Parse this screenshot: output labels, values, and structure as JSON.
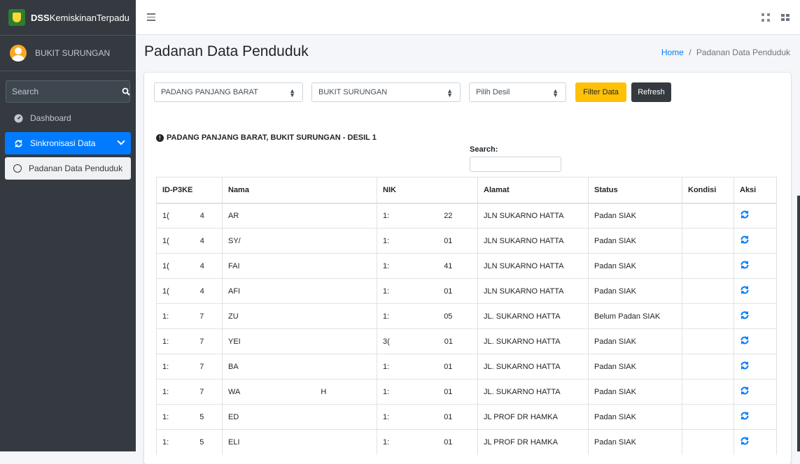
{
  "brand": {
    "bold": "DSS",
    "rest": "KemiskinanTerpadu"
  },
  "user": {
    "name": "BUKIT SURUNGAN"
  },
  "sidebar": {
    "search_placeholder": "Search",
    "items": [
      {
        "label": "Dashboard",
        "icon": "dashboard-icon"
      },
      {
        "label": "Sinkronisasi Data",
        "icon": "sync-icon",
        "active": true
      },
      {
        "label": "Padanan Data Penduduk",
        "icon": "circle-icon",
        "sub": true
      }
    ]
  },
  "page": {
    "title": "Padanan Data Penduduk"
  },
  "breadcrumb": {
    "home": "Home",
    "separator": "/",
    "current": "Padanan Data Penduduk"
  },
  "filters": {
    "kecamatan": "PADANG PANJANG BARAT",
    "kelurahan": "BUKIT SURUNGAN",
    "desil": "Pilih Desil",
    "filter_label": "Filter Data",
    "refresh_label": "Refresh"
  },
  "info": {
    "text": "PADANG PANJANG BARAT, BUKIT SURUNGAN - DESIL 1"
  },
  "datatable": {
    "search_label": "Search:"
  },
  "table": {
    "headers": [
      "ID-P3KE",
      "Nama",
      "NIK",
      "Alamat",
      "Status",
      "Kondisi",
      "Aksi"
    ],
    "rows": [
      {
        "id_a": "1(",
        "id_b": "4",
        "nama": "AR",
        "nama_b": "",
        "nik_a": "1:",
        "nik_b": "22",
        "alamat": "JLN SUKARNO HATTA",
        "status": "Padan SIAK",
        "kondisi": ""
      },
      {
        "id_a": "1(",
        "id_b": "4",
        "nama": "SY/",
        "nama_b": "",
        "nik_a": "1:",
        "nik_b": "01",
        "alamat": "JLN SUKARNO HATTA",
        "status": "Padan SIAK",
        "kondisi": ""
      },
      {
        "id_a": "1(",
        "id_b": "4",
        "nama": "FAI",
        "nama_b": "",
        "nik_a": "1:",
        "nik_b": "41",
        "alamat": "JLN SUKARNO HATTA",
        "status": "Padan SIAK",
        "kondisi": ""
      },
      {
        "id_a": "1(",
        "id_b": "4",
        "nama": "AFI",
        "nama_b": "",
        "nik_a": "1:",
        "nik_b": "01",
        "alamat": "JLN SUKARNO HATTA",
        "status": "Padan SIAK",
        "kondisi": ""
      },
      {
        "id_a": "1:",
        "id_b": "7",
        "nama": "ZU",
        "nama_b": "",
        "nik_a": "1:",
        "nik_b": "05",
        "alamat": "JL. SUKARNO HATTA",
        "status": "Belum Padan SIAK",
        "kondisi": ""
      },
      {
        "id_a": "1:",
        "id_b": "7",
        "nama": "YEI",
        "nama_b": "",
        "nik_a": "3(",
        "nik_b": "01",
        "alamat": "JL. SUKARNO HATTA",
        "status": "Padan SIAK",
        "kondisi": ""
      },
      {
        "id_a": "1:",
        "id_b": "7",
        "nama": "BA",
        "nama_b": "",
        "nik_a": "1:",
        "nik_b": "01",
        "alamat": "JL. SUKARNO HATTA",
        "status": "Padan SIAK",
        "kondisi": ""
      },
      {
        "id_a": "1:",
        "id_b": "7",
        "nama": "WA",
        "nama_b": "H",
        "nik_a": "1:",
        "nik_b": "01",
        "alamat": "JL. SUKARNO HATTA",
        "status": "Padan SIAK",
        "kondisi": ""
      },
      {
        "id_a": "1:",
        "id_b": "5",
        "nama": "ED",
        "nama_b": "",
        "nik_a": "1:",
        "nik_b": "01",
        "alamat": "JL PROF DR HAMKA",
        "status": "Padan SIAK",
        "kondisi": ""
      },
      {
        "id_a": "1:",
        "id_b": "5",
        "nama": "ELI",
        "nama_b": "",
        "nik_a": "1:",
        "nik_b": "01",
        "alamat": "JL PROF DR HAMKA",
        "status": "Padan SIAK",
        "kondisi": ""
      }
    ]
  },
  "colors": {
    "primary": "#007bff",
    "sidebar": "#343a40",
    "warning": "#ffc107"
  }
}
